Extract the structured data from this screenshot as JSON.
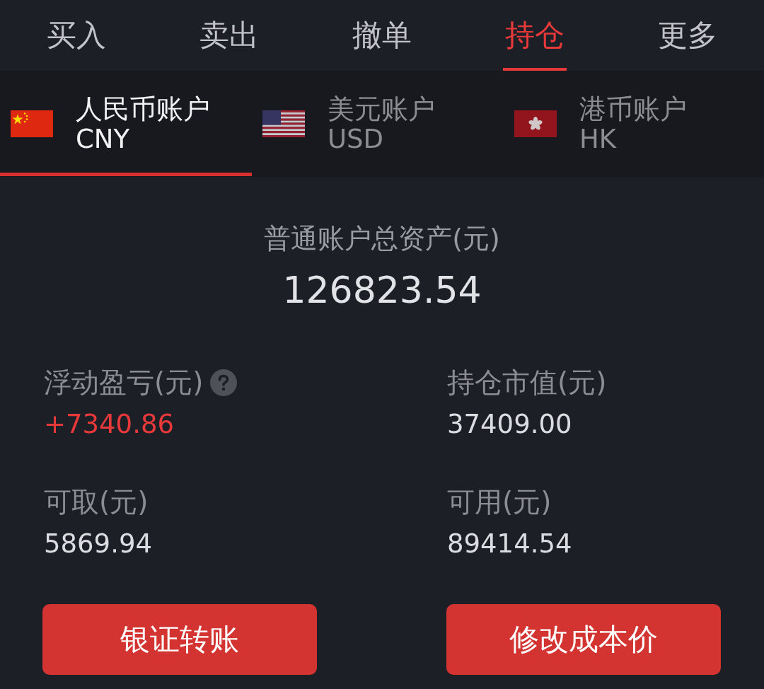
{
  "top_tabs": [
    {
      "label": "买入",
      "selected": false
    },
    {
      "label": "卖出",
      "selected": false
    },
    {
      "label": "撤单",
      "selected": false
    },
    {
      "label": "持仓",
      "selected": true
    },
    {
      "label": "更多",
      "selected": false
    }
  ],
  "account_tabs": [
    {
      "kind": "cn",
      "name": "人民币账户",
      "currency": "CNY",
      "selected": true
    },
    {
      "kind": "us",
      "name": "美元账户",
      "currency": "USD",
      "selected": false
    },
    {
      "kind": "hk",
      "name": "港币账户",
      "currency": "HK",
      "selected": false
    }
  ],
  "summary": {
    "title": "普通账户总资产(元)",
    "total": "126823.54"
  },
  "stats": [
    {
      "label": "浮动盈亏(元)",
      "help": true,
      "value": "+7340.86",
      "color": "#e8393a"
    },
    {
      "label": "持仓市值(元)",
      "help": false,
      "value": "37409.00",
      "color": "#dcdde1"
    },
    {
      "label": "可取(元)",
      "help": false,
      "value": "5869.94",
      "color": "#dcdde1"
    },
    {
      "label": "可用(元)",
      "help": false,
      "value": "89414.54",
      "color": "#dcdde1"
    }
  ],
  "buttons": [
    "银证转账",
    "修改成本价"
  ]
}
